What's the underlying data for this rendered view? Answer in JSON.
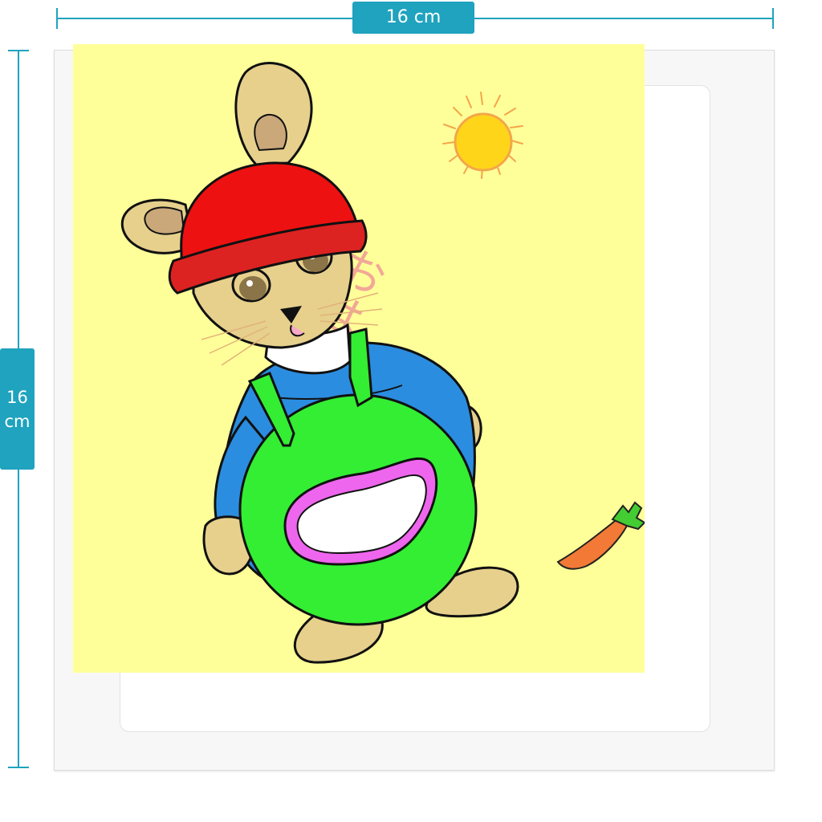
{
  "dimensions": {
    "width_label": "16 cm",
    "height_value": "16",
    "height_unit": "cm"
  },
  "illustration": {
    "subject": "rabbit-in-overalls",
    "greeting_text": "おはよー",
    "colors": {
      "background": "#ffff99",
      "hat": "#ee1111",
      "hat_band": "#dd2222",
      "fur": "#e6d08c",
      "inner_ear": "#caa87a",
      "shirt": "#2b8de0",
      "overalls": "#33ee33",
      "pocket_border": "#ee66ee",
      "pocket": "#ffffff",
      "sun": "#ffd51a",
      "carrot": "#f27a36",
      "carrot_leaves": "#44cc33",
      "text": "#f2a896"
    }
  },
  "accent_color": "#1fa3bf"
}
